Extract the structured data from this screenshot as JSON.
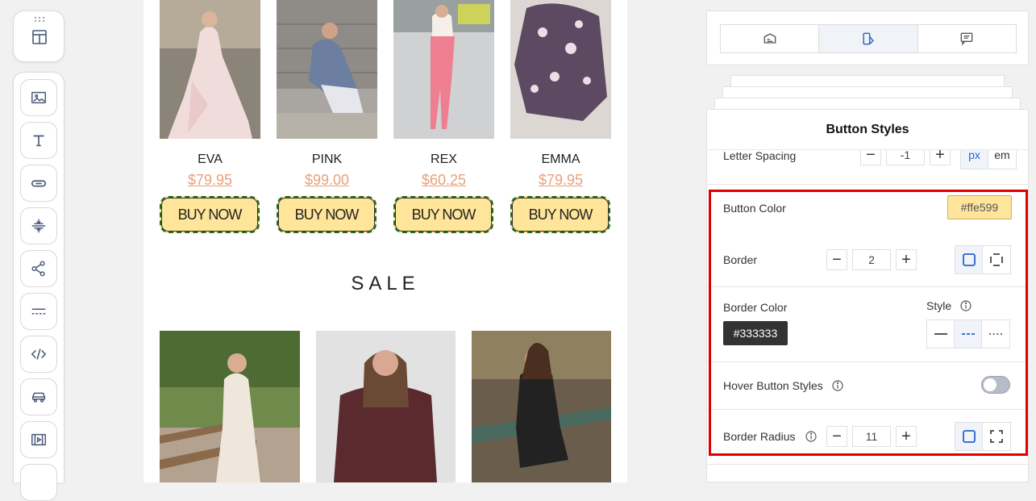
{
  "toolbar": {
    "icons": [
      "layout-icon",
      "image-icon",
      "text-icon",
      "button-icon",
      "divider-icon",
      "social-share-icon",
      "spacer-icon",
      "html-code-icon",
      "car-icon",
      "video-icon"
    ]
  },
  "canvas": {
    "products": [
      {
        "name": "EVA",
        "price": "$79.95",
        "cta": "BUY NOW"
      },
      {
        "name": "PINK",
        "price": "$99.00",
        "cta": "BUY NOW"
      },
      {
        "name": "REX",
        "price": "$60.25",
        "cta": "BUY NOW"
      },
      {
        "name": "EMMA",
        "price": "$79.95",
        "cta": "BUY NOW"
      }
    ],
    "sale_title": "SALE"
  },
  "panel": {
    "tabs": [
      "content-icon",
      "styles-icon",
      "comments-icon"
    ],
    "title": "Button Styles",
    "letter_spacing": {
      "label": "Letter Spacing",
      "value": "-1",
      "units": [
        "px",
        "em"
      ],
      "unit_selected": "px"
    },
    "button_color": {
      "label": "Button Color",
      "value": "#ffe599"
    },
    "border": {
      "label": "Border",
      "value": "2"
    },
    "border_color": {
      "label": "Border Color",
      "value": "#333333",
      "style_label": "Style",
      "style_selected": "dashed"
    },
    "hover": {
      "label": "Hover Button Styles",
      "enabled": false
    },
    "border_radius": {
      "label": "Border Radius",
      "value": "11"
    }
  },
  "colors": {
    "button_fill": "#ffe599",
    "price": "#e8a07a",
    "highlight": "#e00000",
    "accent": "#2a62c9"
  }
}
